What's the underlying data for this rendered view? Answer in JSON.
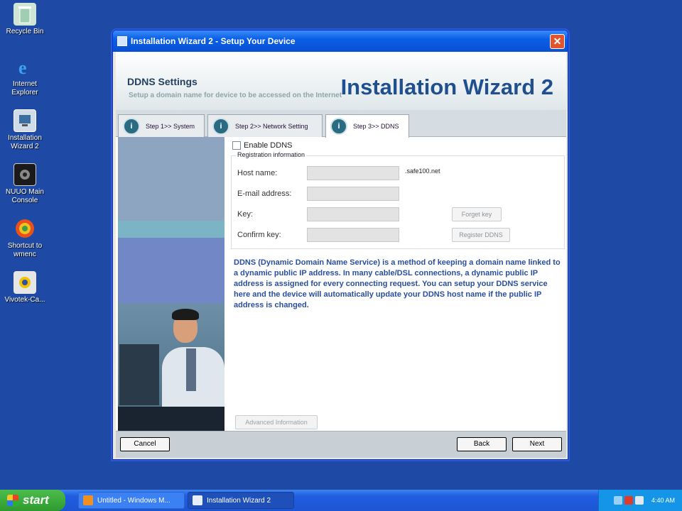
{
  "desktop": {
    "icons": [
      {
        "label": "Recycle Bin",
        "icon": "recycle-bin-icon"
      },
      {
        "label": "Internet Explorer",
        "icon": "ie-icon"
      },
      {
        "label": "Installation Wizard 2",
        "icon": "installer-icon"
      },
      {
        "label": "NUUO Main Console",
        "icon": "console-icon"
      },
      {
        "label": "Shortcut to wmenc",
        "icon": "media-icon"
      },
      {
        "label": "Vivotek-Ca...",
        "icon": "camera-icon"
      }
    ]
  },
  "window": {
    "title": "Installation Wizard 2 - Setup Your Device",
    "close_glyph": "✕"
  },
  "header": {
    "section_title": "DDNS Settings",
    "subtitle": "Setup a domain name for device to be accessed on the Internet",
    "brand": "Installation Wizard 2"
  },
  "tabs": [
    {
      "label": "Step 1>> System",
      "active": false
    },
    {
      "label": "Step 2>> Network Setting",
      "active": false
    },
    {
      "label": "Step 3>> DDNS",
      "active": true
    }
  ],
  "form": {
    "enable_label": "Enable DDNS",
    "legend": "Registration information",
    "host_label": "Host name:",
    "host_suffix": ".safe100.net",
    "email_label": "E-mail address:",
    "key_label": "Key:",
    "confirm_label": "Confirm key:",
    "forget_key": "Forget key",
    "register": "Register DDNS",
    "description": "DDNS (Dynamic Domain Name Service) is a method of keeping a domain name linked to a dynamic public IP address. In many cable/DSL connections, a dynamic public IP address is assigned for every connecting request. You can setup your DDNS service here and the device will automatically update your DDNS host name if the public IP address is changed.",
    "advanced": "Advanced Information"
  },
  "footer": {
    "cancel": "Cancel",
    "back": "Back",
    "next": "Next"
  },
  "taskbar": {
    "start": "start",
    "tasks": [
      {
        "label": "Untitled - Windows M..."
      },
      {
        "label": "Installation Wizard 2"
      }
    ],
    "clock": "4:40 AM"
  }
}
